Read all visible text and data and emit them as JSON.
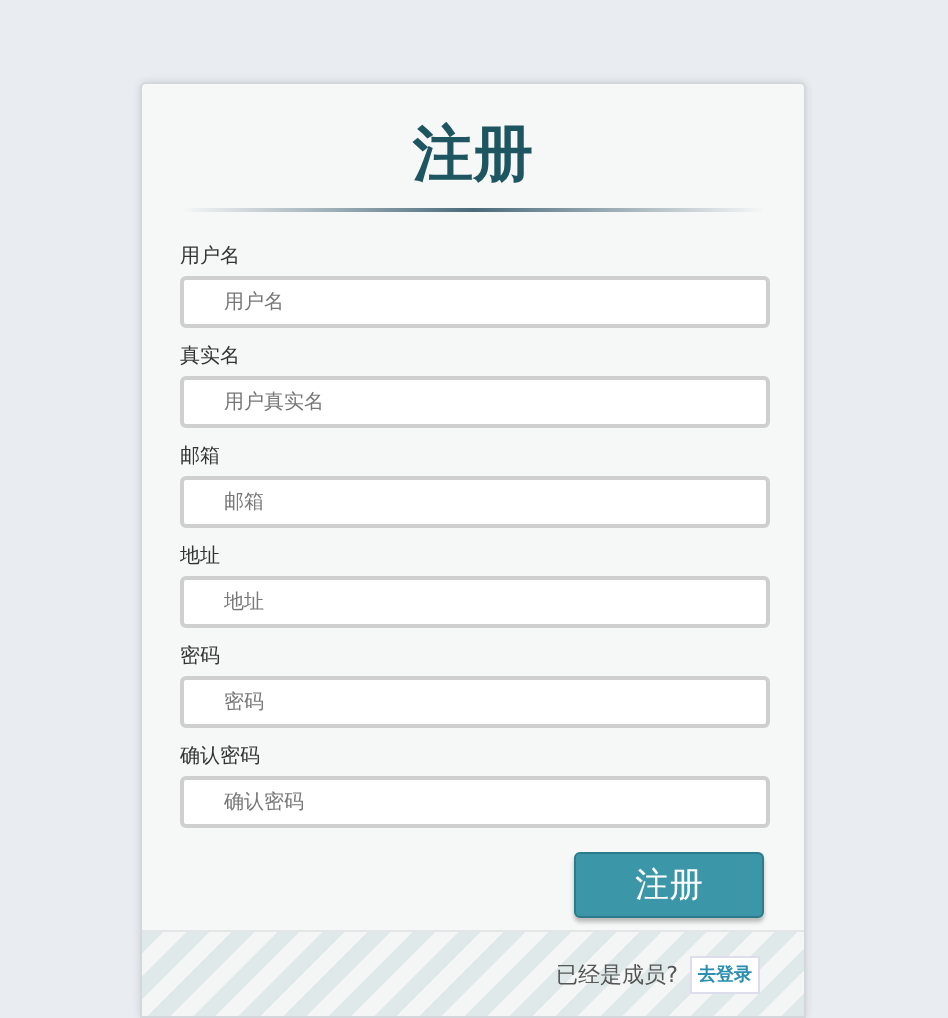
{
  "title": "注册",
  "fields": [
    {
      "label": "用户名",
      "placeholder": "用户名"
    },
    {
      "label": "真实名",
      "placeholder": "用户真实名"
    },
    {
      "label": "邮箱",
      "placeholder": "邮箱"
    },
    {
      "label": "地址",
      "placeholder": "地址"
    },
    {
      "label": "密码",
      "placeholder": "密码"
    },
    {
      "label": "确认密码",
      "placeholder": "确认密码"
    }
  ],
  "submit_button": "注册",
  "footer": {
    "text": "已经是成员?",
    "link": "去登录"
  }
}
